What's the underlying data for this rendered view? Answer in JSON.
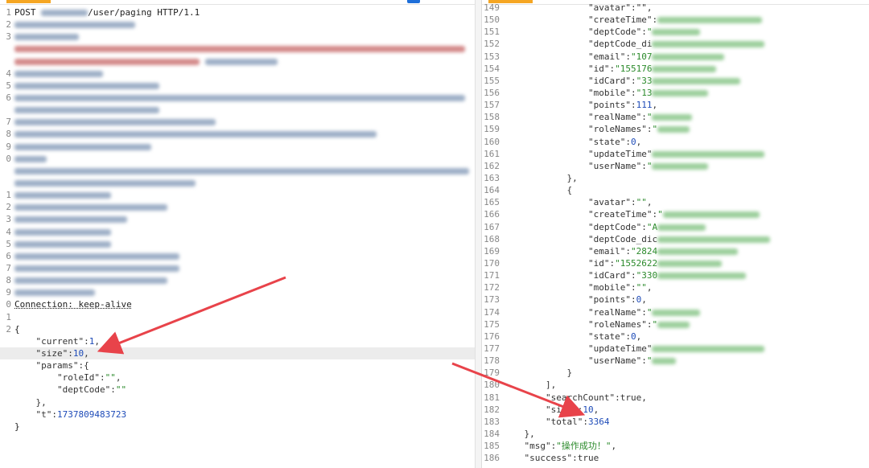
{
  "request": {
    "lines": [
      {
        "n": "1",
        "t": "POST ",
        "blur": "bl",
        "bw": 58,
        "after": "/user/paging HTTP/1.1"
      },
      {
        "n": "2",
        "blurOnly": [
          "bl",
          150
        ]
      },
      {
        "n": "3",
        "blurOnly": [
          "bl",
          80
        ]
      },
      {
        "n": "",
        "blurOnly": [
          "bp",
          560
        ]
      },
      {
        "n": "",
        "blurOnly": [
          "bp",
          230,
          "bl",
          90
        ]
      },
      {
        "n": "4",
        "blurOnly": [
          "bl",
          110
        ]
      },
      {
        "n": "5",
        "blurOnly": [
          "bl",
          180
        ]
      },
      {
        "n": "6",
        "blurOnly": [
          "bl",
          560
        ]
      },
      {
        "n": "",
        "blurOnly": [
          "bl",
          180
        ]
      },
      {
        "n": "7",
        "blurOnly": [
          "bl",
          250
        ]
      },
      {
        "n": "8",
        "blurOnly": [
          "bl",
          450
        ]
      },
      {
        "n": "9",
        "blurOnly": [
          "bl",
          170
        ]
      },
      {
        "n": "0",
        "blurOnly": [
          "bl",
          40
        ]
      },
      {
        "n": "",
        "blurOnly": [
          "bl",
          565
        ]
      },
      {
        "n": "",
        "blurOnly": [
          "bl",
          225
        ]
      },
      {
        "n": "1",
        "blurOnly": [
          "bl",
          120
        ]
      },
      {
        "n": "2",
        "blurOnly": [
          "bl",
          190
        ]
      },
      {
        "n": "3",
        "blurOnly": [
          "bl",
          140
        ]
      },
      {
        "n": "4",
        "blurOnly": [
          "bl",
          120
        ]
      },
      {
        "n": "5",
        "blurOnly": [
          "bl",
          120
        ]
      },
      {
        "n": "6",
        "blurOnly": [
          "bl",
          205
        ]
      },
      {
        "n": "7",
        "blurOnly": [
          "bl",
          205
        ]
      },
      {
        "n": "8",
        "blurOnly": [
          "bl",
          190
        ]
      },
      {
        "n": "9",
        "blurOnly": [
          "bl",
          100
        ]
      },
      {
        "n": "0",
        "t": "Connection: keep-alive",
        "ul": true
      },
      {
        "n": "1",
        "t": ""
      },
      {
        "n": "2",
        "t": "{"
      },
      {
        "n": "",
        "json": [
          [
            "p",
            "    "
          ],
          [
            "k",
            "\"current\""
          ],
          [
            "p",
            ":"
          ],
          [
            "n",
            "1"
          ],
          [
            "p",
            ","
          ]
        ]
      },
      {
        "n": "",
        "json": [
          [
            "p",
            "    "
          ],
          [
            "k",
            "\"size\""
          ],
          [
            "p",
            ":"
          ],
          [
            "n",
            "10"
          ],
          [
            "p",
            ","
          ]
        ],
        "hl": true
      },
      {
        "n": "",
        "json": [
          [
            "p",
            "    "
          ],
          [
            "k",
            "\"params\""
          ],
          [
            "p",
            ":{"
          ]
        ]
      },
      {
        "n": "",
        "json": [
          [
            "p",
            "        "
          ],
          [
            "k",
            "\"roleId\""
          ],
          [
            "p",
            ":"
          ],
          [
            "s",
            "\"\""
          ],
          [
            "p",
            ","
          ]
        ]
      },
      {
        "n": "",
        "json": [
          [
            "p",
            "        "
          ],
          [
            "k",
            "\"deptCode\""
          ],
          [
            "p",
            ":"
          ],
          [
            "s",
            "\"\""
          ]
        ]
      },
      {
        "n": "",
        "json": [
          [
            "p",
            "    },"
          ]
        ]
      },
      {
        "n": "",
        "json": [
          [
            "p",
            "    "
          ],
          [
            "k",
            "\"t\""
          ],
          [
            "p",
            ":"
          ],
          [
            "n",
            "1737809483723"
          ]
        ]
      },
      {
        "n": "",
        "t": "}"
      }
    ]
  },
  "response": {
    "lines": [
      {
        "n": "149",
        "json": [
          [
            "p",
            "                "
          ],
          [
            "k",
            "\"avatar\""
          ],
          [
            "p",
            ":\""
          ],
          [
            "p",
            "\","
          ]
        ]
      },
      {
        "n": "150",
        "json": [
          [
            "p",
            "                "
          ],
          [
            "k",
            "\"createTime\""
          ],
          [
            "p",
            ":"
          ]
        ],
        "blur": [
          "bg",
          130
        ]
      },
      {
        "n": "151",
        "json": [
          [
            "p",
            "                "
          ],
          [
            "k",
            "\"deptCode\""
          ],
          [
            "p",
            ":"
          ],
          [
            "s",
            "\""
          ]
        ],
        "blur": [
          "bg",
          60
        ]
      },
      {
        "n": "152",
        "json": [
          [
            "p",
            "                "
          ],
          [
            "k",
            "\"deptCode_di"
          ]
        ],
        "blur": [
          "bg",
          140
        ]
      },
      {
        "n": "153",
        "json": [
          [
            "p",
            "                "
          ],
          [
            "k",
            "\"email\""
          ],
          [
            "p",
            ":"
          ],
          [
            "s",
            "\"107"
          ]
        ],
        "blur": [
          "bg",
          90
        ]
      },
      {
        "n": "154",
        "json": [
          [
            "p",
            "                "
          ],
          [
            "k",
            "\"id\""
          ],
          [
            "p",
            ":"
          ],
          [
            "s",
            "\"155176"
          ]
        ],
        "blur": [
          "bg",
          80
        ]
      },
      {
        "n": "155",
        "json": [
          [
            "p",
            "                "
          ],
          [
            "k",
            "\"idCard\""
          ],
          [
            "p",
            ":"
          ],
          [
            "s",
            "\"33"
          ]
        ],
        "blur": [
          "bg",
          110
        ]
      },
      {
        "n": "156",
        "json": [
          [
            "p",
            "                "
          ],
          [
            "k",
            "\"mobile\""
          ],
          [
            "p",
            ":"
          ],
          [
            "s",
            "\"13"
          ]
        ],
        "blur": [
          "bg",
          70
        ]
      },
      {
        "n": "157",
        "json": [
          [
            "p",
            "                "
          ],
          [
            "k",
            "\"points\""
          ],
          [
            "p",
            ":"
          ],
          [
            "n",
            "111"
          ],
          [
            "p",
            ","
          ]
        ]
      },
      {
        "n": "158",
        "json": [
          [
            "p",
            "                "
          ],
          [
            "k",
            "\"realName\""
          ],
          [
            "p",
            ":"
          ],
          [
            "s",
            "\""
          ]
        ],
        "blur": [
          "bg",
          50
        ]
      },
      {
        "n": "159",
        "json": [
          [
            "p",
            "                "
          ],
          [
            "k",
            "\"roleNames\""
          ],
          [
            "p",
            ":"
          ],
          [
            "s",
            "\""
          ]
        ],
        "blur": [
          "bg",
          40
        ]
      },
      {
        "n": "160",
        "json": [
          [
            "p",
            "                "
          ],
          [
            "k",
            "\"state\""
          ],
          [
            "p",
            ":"
          ],
          [
            "n",
            "0"
          ],
          [
            "p",
            ","
          ]
        ]
      },
      {
        "n": "161",
        "json": [
          [
            "p",
            "                "
          ],
          [
            "k",
            "\"updateTime\""
          ]
        ],
        "blur": [
          "bg",
          140
        ]
      },
      {
        "n": "162",
        "json": [
          [
            "p",
            "                "
          ],
          [
            "k",
            "\"userName\""
          ],
          [
            "p",
            ":"
          ],
          [
            "s",
            "\""
          ]
        ],
        "blur": [
          "bg",
          70
        ]
      },
      {
        "n": "163",
        "json": [
          [
            "p",
            "            },"
          ]
        ]
      },
      {
        "n": "164",
        "json": [
          [
            "p",
            "            {"
          ]
        ]
      },
      {
        "n": "165",
        "json": [
          [
            "p",
            "                "
          ],
          [
            "k",
            "\"avatar\""
          ],
          [
            "p",
            ":"
          ],
          [
            "s",
            "\"\""
          ],
          [
            "p",
            ","
          ]
        ]
      },
      {
        "n": "166",
        "json": [
          [
            "p",
            "                "
          ],
          [
            "k",
            "\"createTime\""
          ],
          [
            "p",
            ":"
          ],
          [
            "s",
            "\""
          ]
        ],
        "blur": [
          "bg",
          120
        ]
      },
      {
        "n": "167",
        "json": [
          [
            "p",
            "                "
          ],
          [
            "k",
            "\"deptCode\""
          ],
          [
            "p",
            ":"
          ],
          [
            "s",
            "\"A"
          ]
        ],
        "blur": [
          "bg",
          60
        ]
      },
      {
        "n": "168",
        "json": [
          [
            "p",
            "                "
          ],
          [
            "k",
            "\"deptCode_dic"
          ]
        ],
        "blur": [
          "bg",
          140
        ]
      },
      {
        "n": "169",
        "json": [
          [
            "p",
            "                "
          ],
          [
            "k",
            "\"email\""
          ],
          [
            "p",
            ":"
          ],
          [
            "s",
            "\"2824"
          ]
        ],
        "blur": [
          "bg",
          100
        ]
      },
      {
        "n": "170",
        "json": [
          [
            "p",
            "                "
          ],
          [
            "k",
            "\"id\""
          ],
          [
            "p",
            ":"
          ],
          [
            "s",
            "\"1552622"
          ]
        ],
        "blur": [
          "bg",
          80
        ]
      },
      {
        "n": "171",
        "json": [
          [
            "p",
            "                "
          ],
          [
            "k",
            "\"idCard\""
          ],
          [
            "p",
            ":"
          ],
          [
            "s",
            "\"330"
          ]
        ],
        "blur": [
          "bg",
          110
        ]
      },
      {
        "n": "172",
        "json": [
          [
            "p",
            "                "
          ],
          [
            "k",
            "\"mobile\""
          ],
          [
            "p",
            ":"
          ],
          [
            "s",
            "\"\""
          ],
          [
            "p",
            ","
          ]
        ]
      },
      {
        "n": "173",
        "json": [
          [
            "p",
            "                "
          ],
          [
            "k",
            "\"points\""
          ],
          [
            "p",
            ":"
          ],
          [
            "n",
            "0"
          ],
          [
            "p",
            ","
          ]
        ]
      },
      {
        "n": "174",
        "json": [
          [
            "p",
            "                "
          ],
          [
            "k",
            "\"realName\""
          ],
          [
            "p",
            ":"
          ],
          [
            "s",
            "\""
          ]
        ],
        "blur": [
          "bg",
          60
        ]
      },
      {
        "n": "175",
        "json": [
          [
            "p",
            "                "
          ],
          [
            "k",
            "\"roleNames\""
          ],
          [
            "p",
            ":"
          ],
          [
            "s",
            "\""
          ]
        ],
        "blur": [
          "bg",
          40
        ]
      },
      {
        "n": "176",
        "json": [
          [
            "p",
            "                "
          ],
          [
            "k",
            "\"state\""
          ],
          [
            "p",
            ":"
          ],
          [
            "n",
            "0"
          ],
          [
            "p",
            ","
          ]
        ]
      },
      {
        "n": "177",
        "json": [
          [
            "p",
            "                "
          ],
          [
            "k",
            "\"updateTime\""
          ]
        ],
        "blur": [
          "bg",
          140
        ]
      },
      {
        "n": "178",
        "json": [
          [
            "p",
            "                "
          ],
          [
            "k",
            "\"userName\""
          ],
          [
            "p",
            ":"
          ],
          [
            "s",
            "\""
          ]
        ],
        "blur": [
          "bg",
          30
        ]
      },
      {
        "n": "179",
        "json": [
          [
            "p",
            "            }"
          ]
        ]
      },
      {
        "n": "180",
        "json": [
          [
            "p",
            "        ],"
          ]
        ]
      },
      {
        "n": "181",
        "json": [
          [
            "p",
            "        "
          ],
          [
            "k",
            "\"searchCount\""
          ],
          [
            "p",
            ":true,"
          ]
        ]
      },
      {
        "n": "182",
        "json": [
          [
            "p",
            "        "
          ],
          [
            "k",
            "\"size\""
          ],
          [
            "p",
            ":"
          ],
          [
            "n",
            "10"
          ],
          [
            "p",
            ","
          ]
        ]
      },
      {
        "n": "183",
        "json": [
          [
            "p",
            "        "
          ],
          [
            "k",
            "\"total\""
          ],
          [
            "p",
            ":"
          ],
          [
            "n",
            "3364"
          ]
        ]
      },
      {
        "n": "184",
        "json": [
          [
            "p",
            "    },"
          ]
        ]
      },
      {
        "n": "185",
        "json": [
          [
            "p",
            "    "
          ],
          [
            "k",
            "\"msg\""
          ],
          [
            "p",
            ":"
          ],
          [
            "s",
            "\"操作成功！\""
          ],
          [
            "p",
            ","
          ]
        ]
      },
      {
        "n": "186",
        "json": [
          [
            "p",
            "    "
          ],
          [
            "k",
            "\"success\""
          ],
          [
            "p",
            ":true"
          ]
        ]
      }
    ]
  },
  "colors": {
    "arrow": "#e8434a",
    "accent": "#f5a623"
  }
}
